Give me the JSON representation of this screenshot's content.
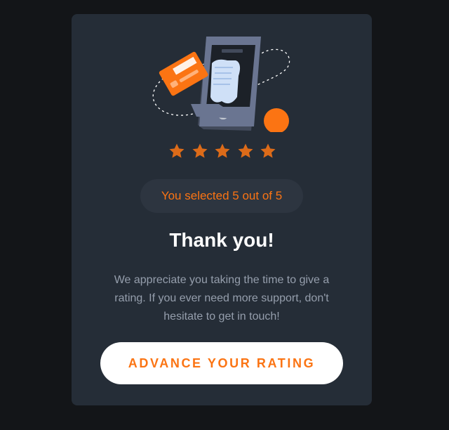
{
  "rating": {
    "selected_text": "You selected 5 out of 5",
    "value": 5,
    "max": 5
  },
  "thanks": {
    "title": "Thank you!",
    "message": "We appreciate you taking the time to give a rating. If you ever need more support, don't hesitate to get in touch!"
  },
  "button": {
    "label": "ADVANCE YOUR RATING"
  },
  "icons": {
    "illustration": "payment-phone-illustration",
    "star": "star-icon"
  },
  "colors": {
    "background": "#131518",
    "card": "#252d37",
    "accent": "#fb7413",
    "star": "#dc6b19",
    "text_muted": "#959eac",
    "title": "#ffffff"
  }
}
